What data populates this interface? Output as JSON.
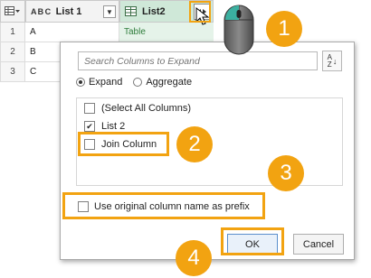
{
  "grid": {
    "columns": [
      {
        "type_label": "A B C",
        "label": "List 1"
      },
      {
        "label": "List2"
      }
    ],
    "rows": [
      {
        "n": "1",
        "c1": "A",
        "c2": "Table"
      },
      {
        "n": "2",
        "c1": "B",
        "c2": ""
      },
      {
        "n": "3",
        "c1": "C",
        "c2": ""
      }
    ]
  },
  "dialog": {
    "search_placeholder": "Search Columns to Expand",
    "sort_glyph_top": "A",
    "sort_glyph_bottom": "Z",
    "radio_expand": "Expand",
    "radio_aggregate": "Aggregate",
    "items": [
      {
        "label": "(Select All Columns)",
        "checked": false
      },
      {
        "label": "List 2",
        "checked": true
      },
      {
        "label": "Join Column",
        "checked": false
      }
    ],
    "prefix_label": "Use original column name as prefix",
    "ok_label": "OK",
    "cancel_label": "Cancel"
  },
  "callouts": [
    "1",
    "2",
    "3",
    "4"
  ],
  "colors": {
    "accent": "#f2a311",
    "list2_header": "#cfe8d8",
    "table_cell": "#e5f3e9",
    "table_text": "#2f7d3c"
  },
  "icons": [
    "table-menu-icon",
    "text-type-icon",
    "dropdown-icon",
    "table-type-icon",
    "expand-icon",
    "cursor-icon",
    "mouse-icon",
    "sort-az-icon",
    "check-icon"
  ]
}
